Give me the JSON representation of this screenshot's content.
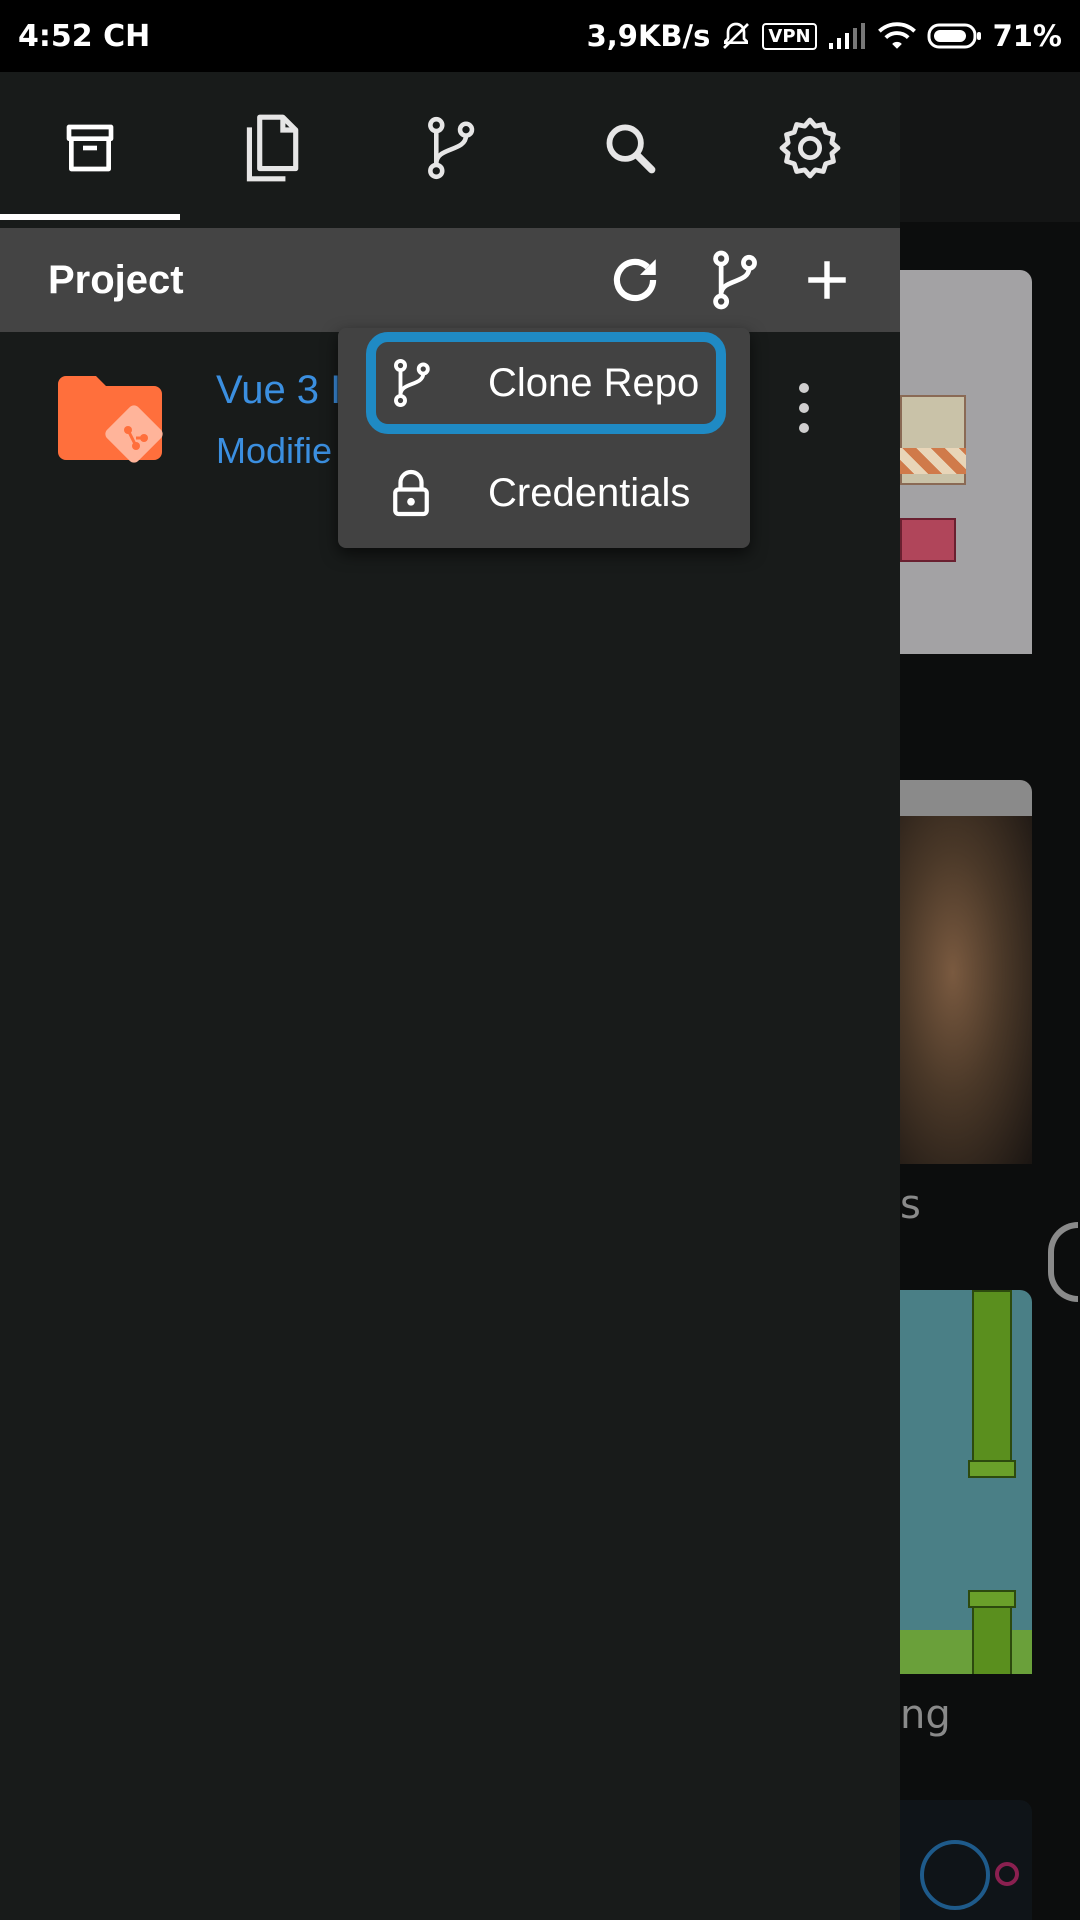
{
  "status_bar": {
    "time": "4:52 CH",
    "network_speed": "3,9KB/s",
    "vpn": "VPN",
    "battery": "71%"
  },
  "tabs": [
    {
      "name": "archive-icon",
      "active": true
    },
    {
      "name": "files-icon",
      "active": false
    },
    {
      "name": "git-branch-icon",
      "active": false
    },
    {
      "name": "search-icon",
      "active": false
    },
    {
      "name": "settings-icon",
      "active": false
    }
  ],
  "project_header": {
    "title": "Project",
    "actions": [
      "refresh-icon",
      "git-branch-icon",
      "add-icon"
    ]
  },
  "project_item": {
    "name": "Vue 3 I",
    "subtitle": "Modifie"
  },
  "menu": {
    "items": [
      {
        "label": "Clone Repo",
        "icon": "git-branch-icon",
        "highlighted": true
      },
      {
        "label": "Credentials",
        "icon": "lock-icon",
        "highlighted": false
      }
    ]
  },
  "background": {
    "text_1": "s",
    "text_2": "ng"
  },
  "colors": {
    "accent_blue": "#3b8fe0",
    "highlight_ring": "#1f8ac4",
    "folder_orange": "#ff6f3c",
    "drawer_bg": "#181b1a",
    "header_bg": "#444444",
    "menu_bg": "#424242"
  }
}
